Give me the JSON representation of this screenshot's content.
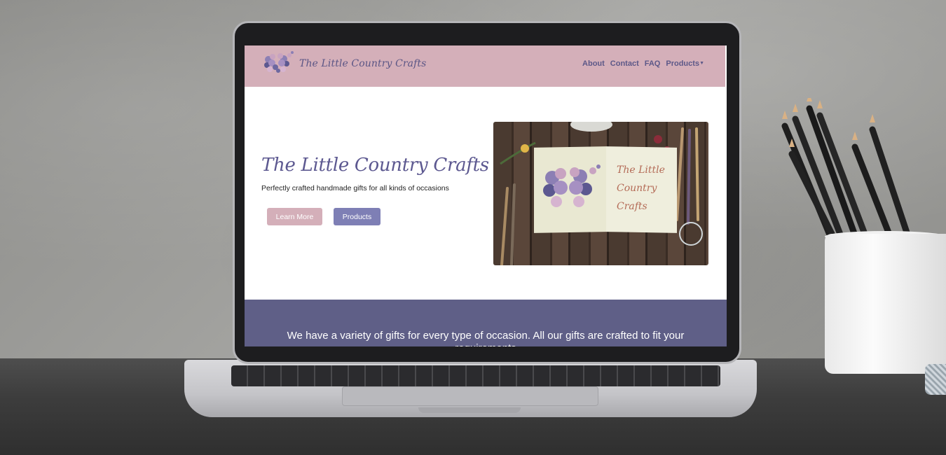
{
  "site": {
    "brand_name": "The Little Country Crafts",
    "nav": {
      "about": "About",
      "contact": "Contact",
      "faq": "FAQ",
      "products": "Products",
      "products_caret": "▼"
    },
    "hero": {
      "title": "The Little Country Crafts",
      "subtitle": "Perfectly crafted handmade gifts for all kinds of occasions",
      "learn_more": "Learn More",
      "products_button": "Products",
      "image_script_line1": "The Little",
      "image_script_line2": "Country Crafts"
    },
    "band": {
      "text": "We have a variety of gifts for every type of occasion. All our gifts are crafted to fit your requirements"
    }
  },
  "colors": {
    "navbar": "#d4afb9",
    "accent_purple": "#5c5890",
    "band": "#5f5f87",
    "button_pink": "#d4afb9",
    "button_purple": "#7e7fb5"
  },
  "icons": {
    "logo": "butterfly-logo-icon",
    "hero_image": "butterfly-sketchbook-image"
  }
}
